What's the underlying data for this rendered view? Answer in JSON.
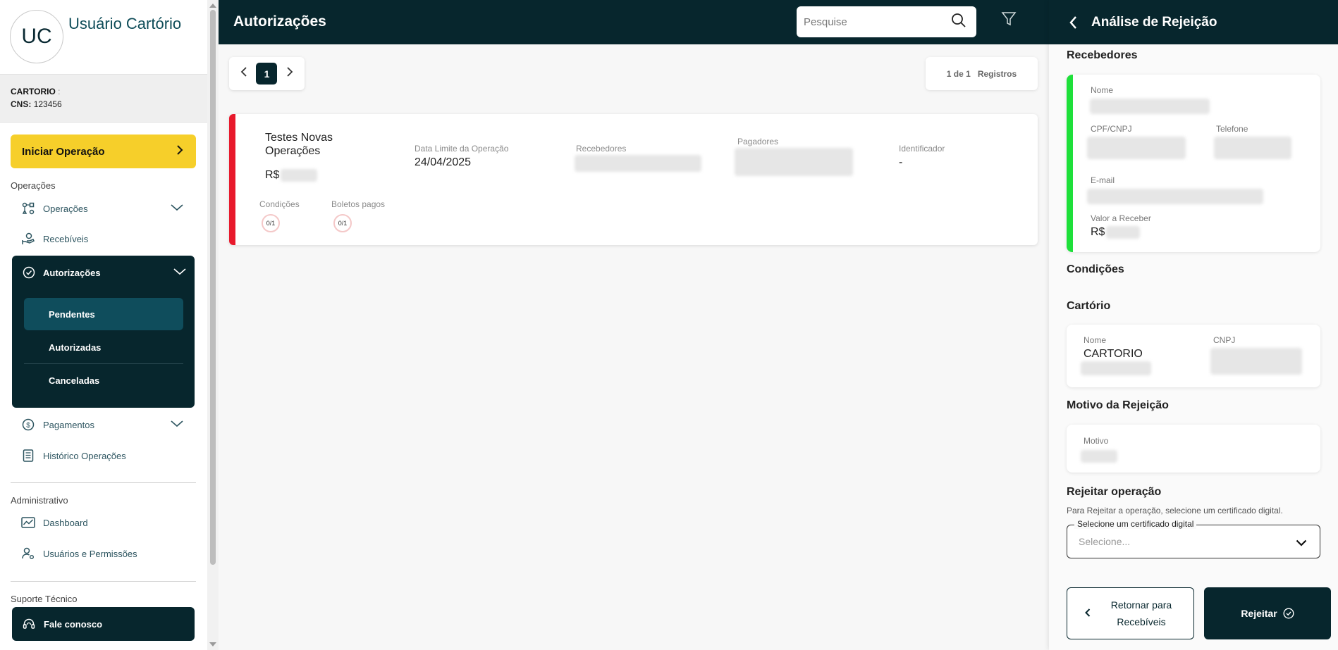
{
  "sidebar": {
    "avatar_initials": "UC",
    "user_name": "Usuário Cartório",
    "cartorio_label": "CARTORIO",
    "cartorio_sep": ":",
    "cns_label": "CNS:",
    "cns_value": "123456",
    "start_button": "Iniciar Operação",
    "sections": {
      "operacoes": "Operações",
      "administrativo": "Administrativo",
      "suporte": "Suporte Técnico"
    },
    "items": {
      "operacoes": "Operações",
      "recebiveis": "Recebíveis",
      "autorizacoes": "Autorizações",
      "pendentes": "Pendentes",
      "autorizadas": "Autorizadas",
      "canceladas": "Canceladas",
      "pagamentos": "Pagamentos",
      "historico": "Histórico Operações",
      "dashboard": "Dashboard",
      "usuarios": "Usuários e Permissões"
    },
    "fale_conosco": "Fale conosco"
  },
  "header": {
    "title": "Autorizações",
    "search_placeholder": "Pesquise"
  },
  "pagination": {
    "current_page": "1",
    "summary": "1 de 1",
    "registros": "Registros"
  },
  "operation": {
    "title": "Testes Novas Operações",
    "amount_prefix": "R$",
    "data_limite_label": "Data Limite da Operação",
    "data_limite_value": "24/04/2025",
    "recebedores_label": "Recebedores",
    "pagadores_label": "Pagadores",
    "identificador_label": "Identificador",
    "identificador_value": "-",
    "condicoes_label": "Condições",
    "condicoes_value": "0/1",
    "boletos_label": "Boletos pagos",
    "boletos_value": "0/1",
    "status_color": "#e8192c"
  },
  "panel": {
    "title": "Análise de Rejeição",
    "recebedores_title": "Recebedores",
    "nome_label": "Nome",
    "cpf_label": "CPF/CNPJ",
    "telefone_label": "Telefone",
    "email_label": "E-mail",
    "valor_label": "Valor a Receber",
    "valor_prefix": "R$",
    "condicoes_title": "Condições",
    "cartorio_title": "Cartório",
    "cartorio_nome_label": "Nome",
    "cartorio_nome_value": "CARTORIO",
    "cnpj_label": "CNPJ",
    "motivo_title": "Motivo da Rejeição",
    "motivo_label": "Motivo",
    "rejeitar_title": "Rejeitar operação",
    "rejeitar_hint": "Para Rejeitar a operação, selecione um certificado digital.",
    "cert_legend": "Selecione um certificado digital",
    "cert_placeholder": "Selecione...",
    "return_button": "Retornar para Recebíveis",
    "reject_button": "Rejeitar",
    "accent_color": "#1ee03a"
  }
}
